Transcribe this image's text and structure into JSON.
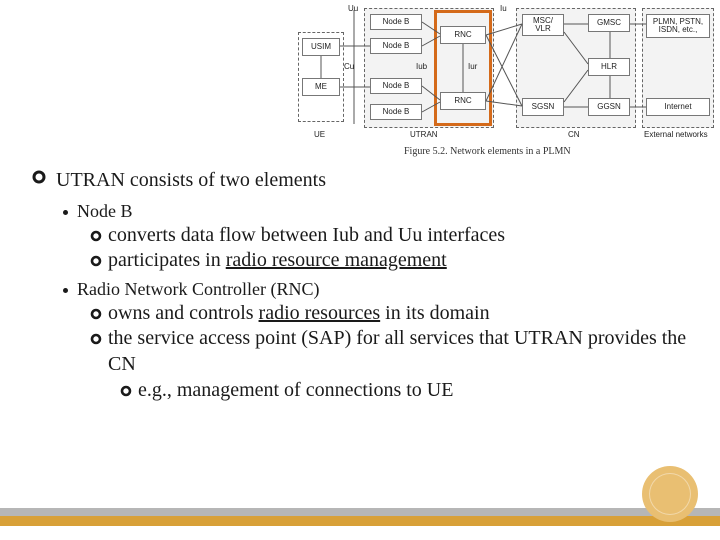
{
  "diagram": {
    "caption": "Figure 5.2. Network elements in a PLMN",
    "group_labels": {
      "ue": "UE",
      "utran": "UTRAN",
      "cn": "CN",
      "ext": "External networks"
    },
    "iface": {
      "uu": "Uu",
      "cu": "Cu",
      "iub": "Iub",
      "iur": "Iur",
      "iu": "Iu"
    },
    "boxes": {
      "usim": "USIM",
      "me": "ME",
      "nodeb1": "Node B",
      "nodeb2": "Node B",
      "nodeb3": "Node B",
      "nodeb4": "Node B",
      "rnc1": "RNC",
      "rnc2": "RNC",
      "mscvlr": "MSC/\nVLR",
      "gmsc": "GMSC",
      "hlr": "HLR",
      "sgsn": "SGSN",
      "ggsn": "GGSN",
      "pstn": "PLMN, PSTN,\nISDN, etc.,",
      "internet": "Internet"
    }
  },
  "bullets": {
    "l1": "UTRAN consists of two elements",
    "nodeb": {
      "title": "Node B",
      "c1": "converts data flow between Iub and Uu interfaces",
      "c2a": "participates in ",
      "c2u": "radio resource management"
    },
    "rnc": {
      "title": "Radio Network Controller (RNC)",
      "c1a": "owns and controls ",
      "c1u": "radio resources",
      "c1b": " in its domain",
      "c2": "the service access point (SAP) for all services that UTRAN provides the CN",
      "c2eg": "e.g., management of connections to UE"
    }
  }
}
